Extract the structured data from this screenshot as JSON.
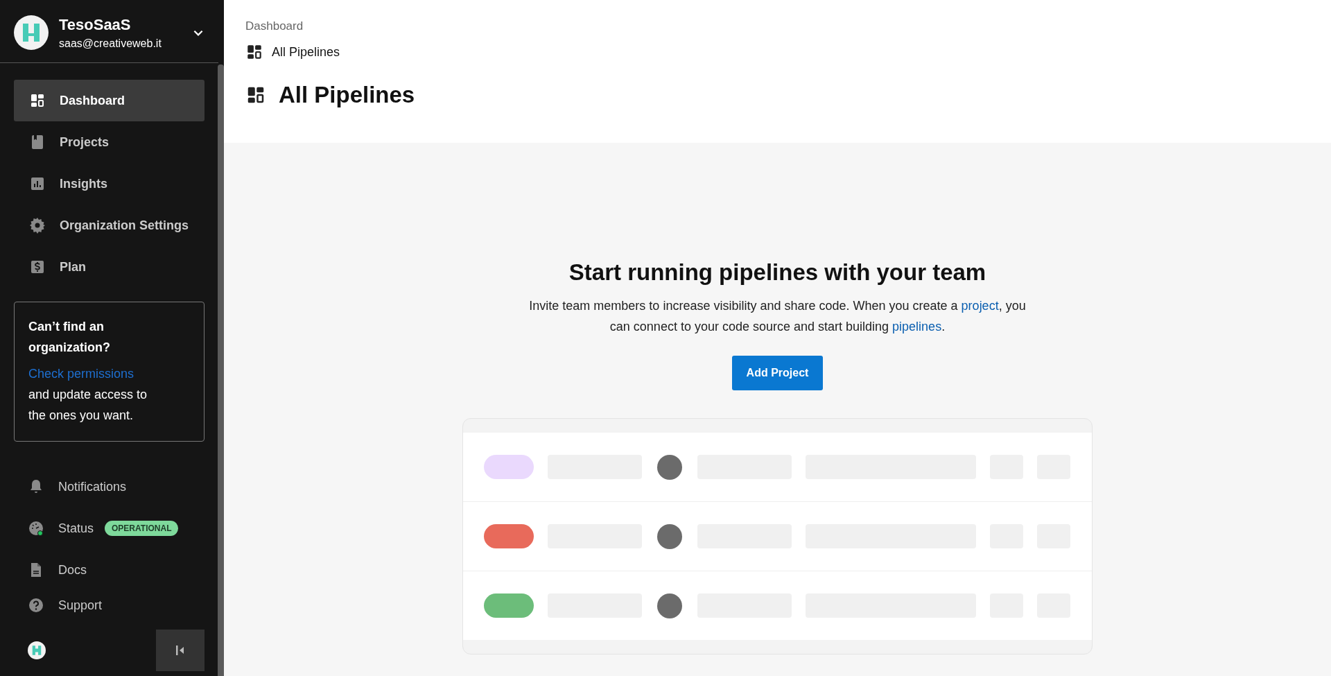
{
  "account": {
    "name": "TesoSaaS",
    "email": "saas@creativeweb.it"
  },
  "nav": [
    {
      "label": "Dashboard",
      "selected": true
    },
    {
      "label": "Projects",
      "selected": false
    },
    {
      "label": "Insights",
      "selected": false
    },
    {
      "label": "Organization Settings",
      "selected": false
    },
    {
      "label": "Plan",
      "selected": false
    }
  ],
  "notice": {
    "title": "Can’t find an organization?",
    "link": "Check permissions",
    "text": " and update access to the ones you want."
  },
  "footer_nav": [
    {
      "label": "Notifications"
    },
    {
      "label": "Status",
      "badge": "OPERATIONAL"
    },
    {
      "label": "Docs"
    },
    {
      "label": "Support"
    }
  ],
  "breadcrumb": {
    "parent": "Dashboard",
    "current": "All Pipelines"
  },
  "page_title": "All Pipelines",
  "empty_state": {
    "heading": "Start running pipelines with your team",
    "text_before": "Invite team members to increase visibility and share code. When you create a ",
    "link_1": "project",
    "text_middle": ", you can connect to your code source and start building ",
    "link_2": "pipelines",
    "text_after": ".",
    "button": "Add Project"
  },
  "preview_rows": [
    {
      "color": "#ead9fd"
    },
    {
      "color": "#e86a5b"
    },
    {
      "color": "#6cbd7a"
    }
  ]
}
